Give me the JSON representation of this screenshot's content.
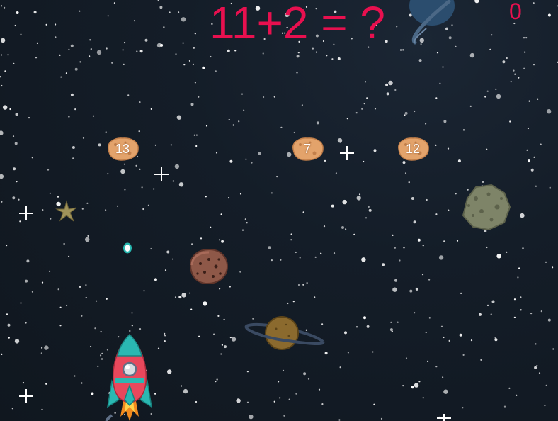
{
  "question": "11+2 = ?",
  "score": "0",
  "answers": [
    {
      "value": "13"
    },
    {
      "value": "7"
    },
    {
      "value": "12"
    }
  ],
  "colors": {
    "background": "#141d28",
    "text_accent": "#e8104f",
    "asteroid": "#e3a36b",
    "rocket_body": "#e8485c",
    "rocket_trim": "#2ab8b2"
  },
  "icons": [
    "rocket-icon",
    "asteroid-icon",
    "planet-icon",
    "ringed-planet-icon",
    "star-icon",
    "sparkle-icon",
    "laser-icon"
  ]
}
